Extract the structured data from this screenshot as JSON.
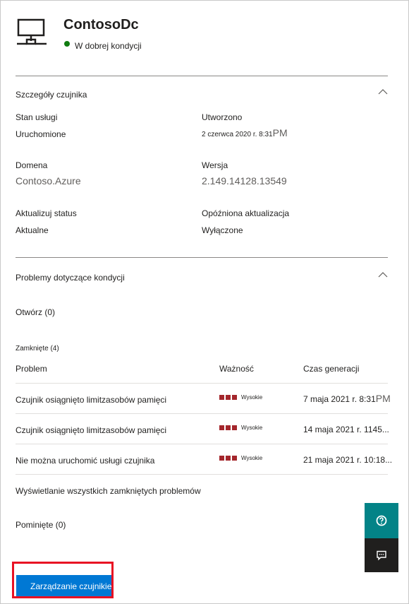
{
  "header": {
    "title": "ContosoDc",
    "status": "W dobrej kondycji",
    "status_color": "#107c10",
    "icon": "monitor-network-icon"
  },
  "sensor_details": {
    "title": "Szczegóły czujnika",
    "service_status_label": "Stan usługi",
    "service_status_value": "Uruchomione",
    "created_label": "Utworzono",
    "created_value": "2 czerwca 2020 r. 8:31",
    "created_suffix": "PM",
    "domain_label": "Domena",
    "domain_value": "Contoso.Azure",
    "version_label": "Wersja",
    "version_value": "2.149.14128.13549",
    "update_status_label": "Aktualizuj status",
    "update_status_value": "Aktualne",
    "delayed_update_label": "Opóźniona aktualizacja",
    "delayed_update_value": "Wyłączone"
  },
  "health_issues": {
    "title": "Problemy dotyczące kondycji",
    "open_label": "Otwórz (0)",
    "closed_label": "Zamknięte (4)",
    "columns": [
      "Problem",
      "Ważność",
      "Czas generacji"
    ],
    "rows": [
      {
        "problem": "Czujnik osiągnięto limitzasobów pamięci",
        "severity": "Wysokie",
        "time": "7 maja 2021 r. 8:31",
        "time_suffix": "PM"
      },
      {
        "problem": "Czujnik osiągnięto limitzasobów pamięci",
        "severity": "Wysokie",
        "time": "14 maja 2021 r. 1145...",
        "time_suffix": ""
      },
      {
        "problem": "Nie można uruchomić usługi czujnika",
        "severity": "Wysokie",
        "time": "21 maja 2021 r. 10:18...",
        "time_suffix": ""
      }
    ],
    "severity_color": "#a4262c",
    "view_all_link": "Wyświetlanie wszystkich zamkniętych problemów",
    "ignored_label": "Pominięte (0)"
  },
  "actions": {
    "manage_sensor_label": "Zarządzanie czujnikiem",
    "accent_color": "#0078d4",
    "help_icon": "question-icon",
    "feedback_icon": "feedback-icon"
  }
}
